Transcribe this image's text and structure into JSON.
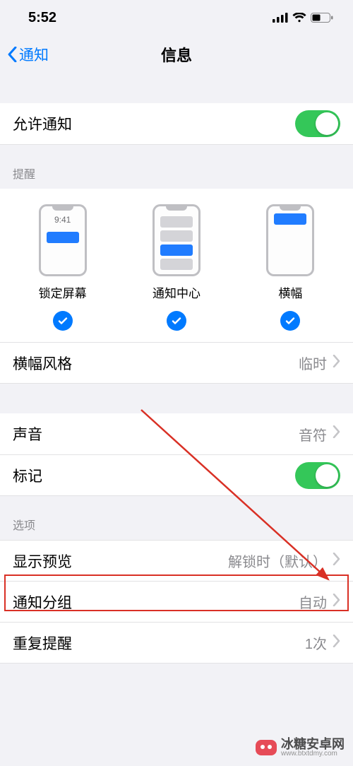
{
  "status": {
    "time": "5:52"
  },
  "nav": {
    "back": "通知",
    "title": "信息"
  },
  "allow_row": {
    "label": "允许通知"
  },
  "alerts": {
    "header": "提醒",
    "lock": {
      "label": "锁定屏幕",
      "mock_time": "9:41"
    },
    "center": {
      "label": "通知中心"
    },
    "banner": {
      "label": "横幅"
    },
    "style_row": {
      "label": "横幅风格",
      "value": "临时"
    }
  },
  "sound_row": {
    "label": "声音",
    "value": "音符"
  },
  "badge_row": {
    "label": "标记"
  },
  "options": {
    "header": "选项",
    "preview": {
      "label": "显示预览",
      "value": "解锁时（默认）"
    },
    "grouping": {
      "label": "通知分组",
      "value": "自动"
    },
    "repeat": {
      "label": "重复提醒",
      "value": "1次"
    }
  },
  "watermark": {
    "text": "冰糖安卓网",
    "url": "www.btxtdmy.com"
  }
}
